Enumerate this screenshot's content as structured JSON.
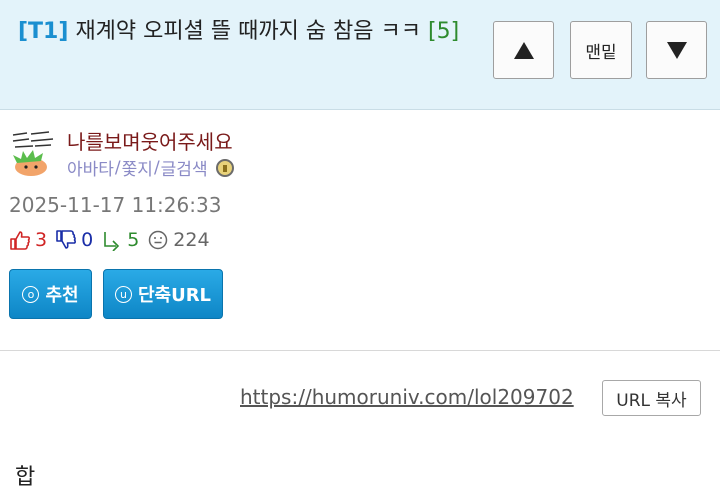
{
  "header": {
    "tag": "[T1]",
    "title": "재계약 오피셜 뜰 때까지 숨 참음 ㅋㅋ",
    "comment_count": "[5]",
    "bottom_button": "맨밑"
  },
  "author": {
    "nickname": "나를보며웃어주세요",
    "links": [
      "아바타",
      "쫓지",
      "글검색"
    ],
    "avatar_icon": "avatar-image",
    "medal_icon": "medal-icon"
  },
  "post": {
    "date": "2025-11-17 11:26:33",
    "upvotes": "3",
    "downvotes": "0",
    "replies": "5",
    "views": "224"
  },
  "actions": {
    "recommend_key": "o",
    "recommend_label": "추천",
    "shorturl_key": "u",
    "shorturl_label": "단축URL"
  },
  "url": {
    "link": "https://humoruniv.com/lol209702",
    "copy_label": "URL 복사"
  },
  "content": {
    "text": "합"
  },
  "colors": {
    "header_bg": "#e3f3fa",
    "tag": "#1a8fd0",
    "count": "#2e8b2e",
    "button_blue": "#1a9ad8",
    "nickname": "#7a1a1a",
    "links": "#8a8ac6"
  }
}
